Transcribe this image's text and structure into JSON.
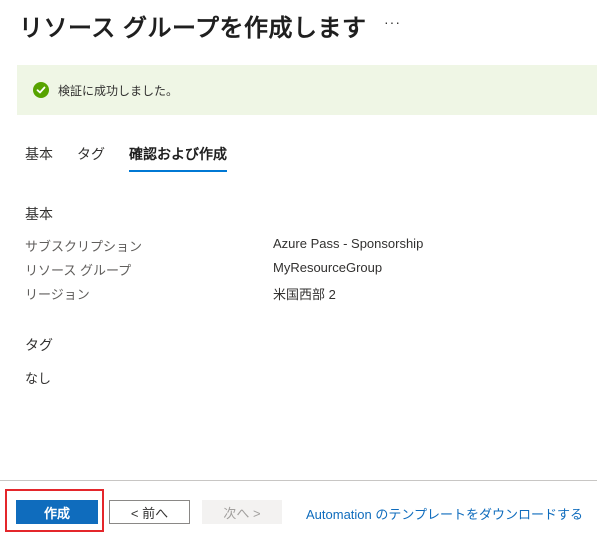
{
  "header": {
    "title": "リソース グループを作成します",
    "more_label": "···"
  },
  "banner": {
    "icon": "check-circle-icon",
    "message": "検証に成功しました。",
    "color": "#57a300"
  },
  "tabs": [
    {
      "label": "基本",
      "active": false
    },
    {
      "label": "タグ",
      "active": false
    },
    {
      "label": "確認および作成",
      "active": true
    }
  ],
  "basics": {
    "heading": "基本",
    "rows": [
      {
        "key": "サブスクリプション",
        "value": "Azure Pass - Sponsorship"
      },
      {
        "key": "リソース グループ",
        "value": "MyResourceGroup"
      },
      {
        "key": "リージョン",
        "value": "米国西部 2"
      }
    ]
  },
  "tags_section": {
    "heading": "タグ",
    "value": "なし"
  },
  "footer": {
    "create_label": "作成",
    "prev_label": "< 前へ",
    "next_label": "次へ >",
    "download_label": "Automation のテンプレートをダウンロードする"
  },
  "colors": {
    "accent": "#0078d4",
    "primary_button": "#0f6cbd",
    "highlight": "#e4262b"
  }
}
